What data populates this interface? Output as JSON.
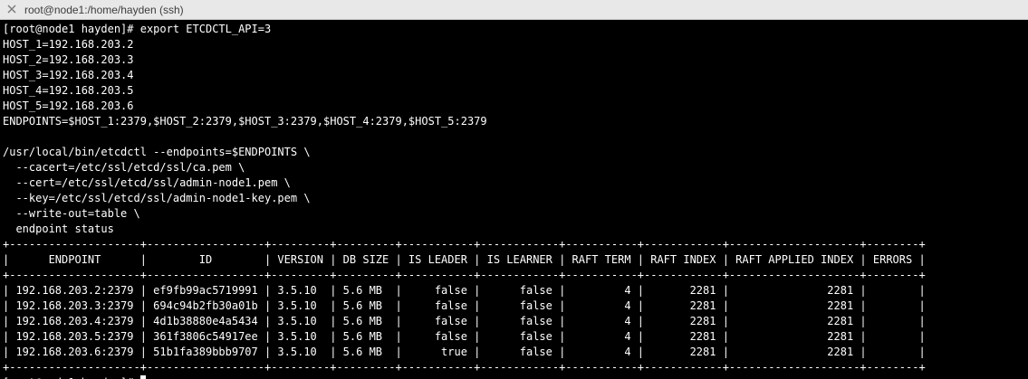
{
  "window": {
    "title": "root@node1:/home/hayden (ssh)",
    "colors": {
      "background": "#000000",
      "foreground": "#ffffff",
      "titlebar": "#e8e8e8"
    }
  },
  "icons": {
    "close": "close-icon"
  },
  "terminal": {
    "command_lines": [
      "[root@node1 hayden]# export ETCDCTL_API=3",
      "HOST_1=192.168.203.2",
      "HOST_2=192.168.203.3",
      "HOST_3=192.168.203.4",
      "HOST_4=192.168.203.5",
      "HOST_5=192.168.203.6",
      "ENDPOINTS=$HOST_1:2379,$HOST_2:2379,$HOST_3:2379,$HOST_4:2379,$HOST_5:2379",
      "",
      "/usr/local/bin/etcdctl --endpoints=$ENDPOINTS \\",
      "  --cacert=/etc/ssl/etcd/ssl/ca.pem \\",
      "  --cert=/etc/ssl/etcd/ssl/admin-node1.pem \\",
      "  --key=/etc/ssl/etcd/ssl/admin-node1-key.pem \\",
      "  --write-out=table \\",
      "  endpoint status"
    ],
    "table": {
      "columns": [
        "ENDPOINT",
        "ID",
        "VERSION",
        "DB SIZE",
        "IS LEADER",
        "IS LEARNER",
        "RAFT TERM",
        "RAFT INDEX",
        "RAFT APPLIED INDEX",
        "ERRORS"
      ],
      "rows": [
        [
          "192.168.203.2:2379",
          "ef9fb99ac5719991",
          "3.5.10",
          "5.6 MB",
          "false",
          "false",
          "4",
          "2281",
          "2281",
          ""
        ],
        [
          "192.168.203.3:2379",
          "694c94b2fb30a01b",
          "3.5.10",
          "5.6 MB",
          "false",
          "false",
          "4",
          "2281",
          "2281",
          ""
        ],
        [
          "192.168.203.4:2379",
          "4d1b38880e4a5434",
          "3.5.10",
          "5.6 MB",
          "false",
          "false",
          "4",
          "2281",
          "2281",
          ""
        ],
        [
          "192.168.203.5:2379",
          "361f3806c54917ee",
          "3.5.10",
          "5.6 MB",
          "false",
          "false",
          "4",
          "2281",
          "2281",
          ""
        ],
        [
          "192.168.203.6:2379",
          "51b1fa389bbb9707",
          "3.5.10",
          "5.6 MB",
          "true",
          "false",
          "4",
          "2281",
          "2281",
          ""
        ]
      ]
    },
    "prompt": "[root@node1 hayden]# "
  }
}
